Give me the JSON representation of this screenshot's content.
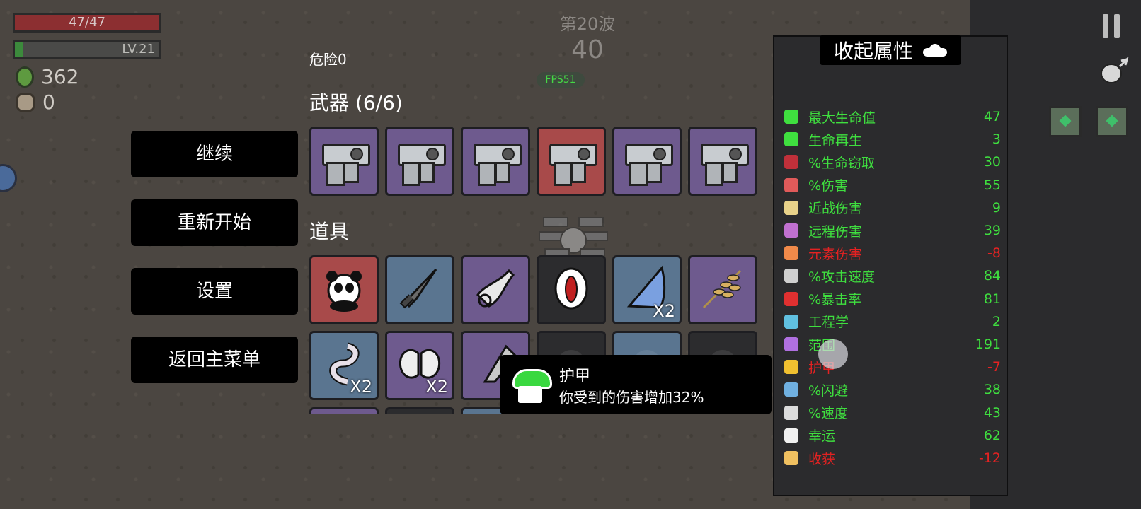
{
  "hud": {
    "hp_text": "47/47",
    "hp_fraction": 1.0,
    "level_text": "LV.21",
    "xp_fraction": 0.06,
    "materials": "362",
    "bag_count": "0"
  },
  "wave": {
    "title": "第20波",
    "timer": "40",
    "fps": "FPS51"
  },
  "danger": "危险0",
  "menu": {
    "continue": "继续",
    "restart": "重新开始",
    "settings": "设置",
    "main_menu": "返回主菜单"
  },
  "weapons": {
    "title": "武器 (6/6)",
    "slots": [
      {
        "name": "smg",
        "rarity": "purple"
      },
      {
        "name": "smg",
        "rarity": "purple"
      },
      {
        "name": "smg",
        "rarity": "purple"
      },
      {
        "name": "smg",
        "rarity": "red"
      },
      {
        "name": "smg",
        "rarity": "purple"
      },
      {
        "name": "smg",
        "rarity": "purple"
      }
    ]
  },
  "items": {
    "title": "道具",
    "row1": [
      {
        "icon": "panda-icon",
        "rarity": "red",
        "count": ""
      },
      {
        "icon": "missile-icon",
        "rarity": "blue",
        "count": ""
      },
      {
        "icon": "potion-icon",
        "rarity": "purple",
        "count": ""
      },
      {
        "icon": "mouth-icon",
        "rarity": "dark",
        "count": ""
      },
      {
        "icon": "fin-icon",
        "rarity": "blue",
        "count": "X2"
      },
      {
        "icon": "wheat-icon",
        "rarity": "purple",
        "count": ""
      }
    ],
    "row2": [
      {
        "icon": "worm-icon",
        "rarity": "blue",
        "count": "X2"
      },
      {
        "icon": "wings-icon",
        "rarity": "purple",
        "count": "X2"
      },
      {
        "icon": "hammer-icon",
        "rarity": "purple",
        "count": ""
      },
      {
        "icon": "unknown-icon",
        "rarity": "dark",
        "count": ""
      },
      {
        "icon": "unknown-icon",
        "rarity": "blue",
        "count": ""
      },
      {
        "icon": "unknown-icon",
        "rarity": "dark",
        "count": ""
      }
    ]
  },
  "tooltip": {
    "title": "护甲",
    "desc": "你受到的伤害增加32%"
  },
  "stats_panel": {
    "toggle_label": "收起属性",
    "stats": [
      {
        "icon": "heart-icon",
        "name": "最大生命值",
        "value": "47",
        "color": "#3fdf3f",
        "icon_color": "#3fdf3f"
      },
      {
        "icon": "regen-icon",
        "name": "生命再生",
        "value": "3",
        "color": "#3fdf3f",
        "icon_color": "#3fdf3f"
      },
      {
        "icon": "lifesteal-icon",
        "name": "%生命窃取",
        "value": "30",
        "color": "#3fdf3f",
        "icon_color": "#c0303a"
      },
      {
        "icon": "damage-icon",
        "name": "%伤害",
        "value": "55",
        "color": "#3fdf3f",
        "icon_color": "#e05a5a"
      },
      {
        "icon": "melee-icon",
        "name": "近战伤害",
        "value": "9",
        "color": "#3fdf3f",
        "icon_color": "#e8d28a"
      },
      {
        "icon": "ranged-icon",
        "name": "远程伤害",
        "value": "39",
        "color": "#3fdf3f",
        "icon_color": "#c070d0"
      },
      {
        "icon": "elemental-icon",
        "name": "元素伤害",
        "value": "-8",
        "color": "#e42222",
        "icon_color": "#f08a4a"
      },
      {
        "icon": "attack-speed-icon",
        "name": "%攻击速度",
        "value": "84",
        "color": "#3fdf3f",
        "icon_color": "#cfcfcf"
      },
      {
        "icon": "crit-icon",
        "name": "%暴击率",
        "value": "81",
        "color": "#3fdf3f",
        "icon_color": "#e03030"
      },
      {
        "icon": "engineering-icon",
        "name": "工程学",
        "value": "2",
        "color": "#3fdf3f",
        "icon_color": "#60c0e0"
      },
      {
        "icon": "range-icon",
        "name": "范围",
        "value": "191",
        "color": "#3fdf3f",
        "icon_color": "#b070e0"
      },
      {
        "icon": "armor-icon",
        "name": "护甲",
        "value": "-7",
        "color": "#e42222",
        "icon_color": "#f0c030"
      },
      {
        "icon": "dodge-icon",
        "name": "%闪避",
        "value": "38",
        "color": "#3fdf3f",
        "icon_color": "#70b0e0"
      },
      {
        "icon": "speed-icon",
        "name": "%速度",
        "value": "43",
        "color": "#3fdf3f",
        "icon_color": "#dcdcdc"
      },
      {
        "icon": "luck-icon",
        "name": "幸运",
        "value": "62",
        "color": "#3fdf3f",
        "icon_color": "#f0f0f0"
      },
      {
        "icon": "harvest-icon",
        "name": "收获",
        "value": "-12",
        "color": "#e42222",
        "icon_color": "#f0c060"
      }
    ]
  }
}
